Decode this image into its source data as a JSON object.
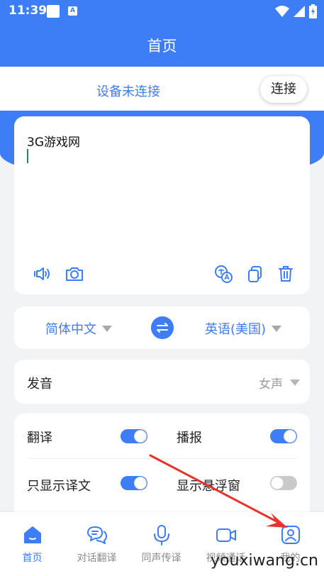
{
  "status_bar": {
    "time": "11:39",
    "app_icon_letter": "A"
  },
  "header": {
    "title": "首页"
  },
  "connection": {
    "status": "设备未连接",
    "connect_label": "连接"
  },
  "input": {
    "text": "3G游戏网"
  },
  "languages": {
    "source": "简体中文",
    "target": "英语(美国)"
  },
  "voice": {
    "label": "发音",
    "value": "女声"
  },
  "settings": [
    {
      "label": "翻译",
      "on": true
    },
    {
      "label": "播报",
      "on": true
    },
    {
      "label": "只显示译文",
      "on": true
    },
    {
      "label": "显示悬浮窗",
      "on": false
    }
  ],
  "nav": [
    {
      "label": "首页",
      "icon": "home-icon",
      "active": true
    },
    {
      "label": "对话翻译",
      "icon": "chat-icon",
      "active": false
    },
    {
      "label": "同声传译",
      "icon": "mic-icon",
      "active": false
    },
    {
      "label": "视频通话",
      "icon": "video-icon",
      "active": false
    },
    {
      "label": "我的",
      "icon": "profile-icon",
      "active": false
    }
  ],
  "watermark": "youxiwang.cn",
  "colors": {
    "primary": "#3d7df6",
    "background": "#f2f3f5",
    "annotation_arrow": "#e8322b"
  }
}
